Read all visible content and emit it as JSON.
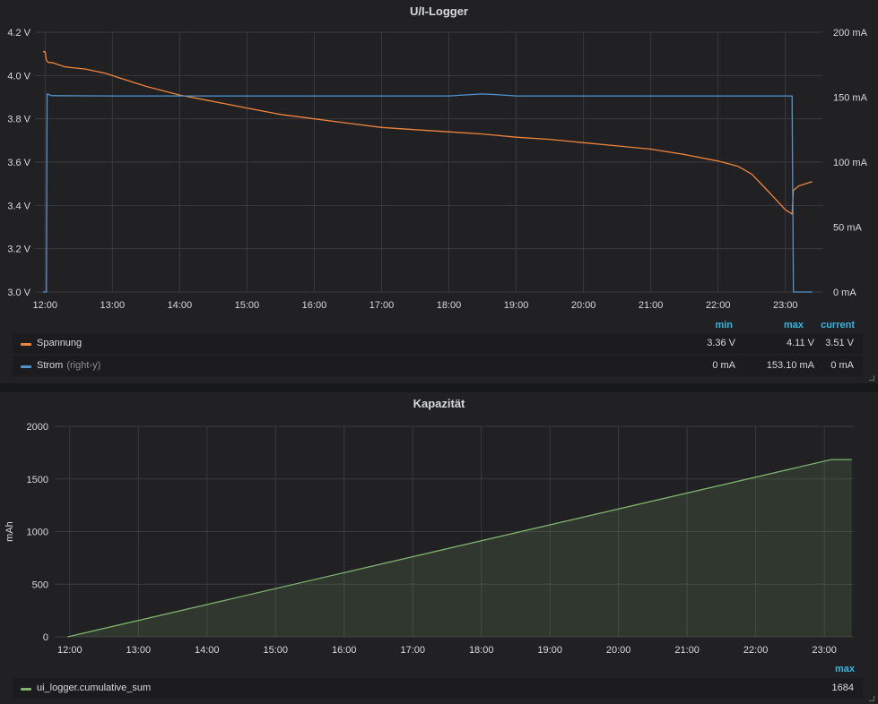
{
  "colors": {
    "spannung": "#ef843c",
    "strom": "#5195ce",
    "cumsum": "#7eb26d",
    "legend_header": "#33b5e5",
    "grid": "#3a3a3e",
    "axis_text": "#d8d9da"
  },
  "panels": {
    "ui_logger": {
      "title": "U/I-Logger",
      "legend": {
        "headers": [
          "min",
          "max",
          "current"
        ],
        "rows": [
          {
            "name": "Spannung",
            "suffix": "",
            "min": "3.36 V",
            "max": "4.11 V",
            "current": "3.51 V"
          },
          {
            "name": "Strom",
            "suffix": "(right-y)",
            "min": "0 mA",
            "max": "153.10 mA",
            "current": "0 mA"
          }
        ]
      }
    },
    "kapazitaet": {
      "title": "Kapazität",
      "legend": {
        "headers": [
          "max"
        ],
        "rows": [
          {
            "name": "ui_logger.cumulative_sum",
            "max": "1684"
          }
        ]
      }
    }
  },
  "chart_data": [
    {
      "type": "line",
      "title": "U/I-Logger",
      "x_ticks": [
        "12:00",
        "13:00",
        "14:00",
        "15:00",
        "16:00",
        "17:00",
        "18:00",
        "19:00",
        "20:00",
        "21:00",
        "22:00",
        "23:00"
      ],
      "y_left": {
        "ylim": [
          3.0,
          4.2
        ],
        "ticks": [
          "3.0 V",
          "3.2 V",
          "3.4 V",
          "3.6 V",
          "3.8 V",
          "4.0 V",
          "4.2 V"
        ]
      },
      "y_right": {
        "ylim": [
          0,
          200
        ],
        "ticks": [
          "0 mA",
          "50 mA",
          "100 mA",
          "150 mA",
          "200 mA"
        ]
      },
      "grid": true,
      "legend_position": "bottom",
      "series": [
        {
          "name": "Spannung",
          "axis": "left",
          "x": [
            11.97,
            12.0,
            12.02,
            12.05,
            12.1,
            12.3,
            12.6,
            12.9,
            13.2,
            13.5,
            14.0,
            14.5,
            15.0,
            15.5,
            16.0,
            16.5,
            17.0,
            17.5,
            18.0,
            18.5,
            19.0,
            19.5,
            20.0,
            20.5,
            21.0,
            21.5,
            22.0,
            22.3,
            22.5,
            22.7,
            22.85,
            23.0,
            23.1,
            23.12,
            23.2,
            23.4
          ],
          "y": [
            4.11,
            4.11,
            4.07,
            4.06,
            4.06,
            4.04,
            4.03,
            4.01,
            3.98,
            3.95,
            3.91,
            3.88,
            3.85,
            3.82,
            3.8,
            3.78,
            3.76,
            3.75,
            3.74,
            3.73,
            3.715,
            3.705,
            3.69,
            3.675,
            3.66,
            3.635,
            3.605,
            3.58,
            3.545,
            3.48,
            3.43,
            3.38,
            3.36,
            3.47,
            3.49,
            3.51
          ]
        },
        {
          "name": "Strom",
          "axis": "right",
          "x": [
            11.97,
            12.02,
            12.03,
            12.1,
            13.0,
            14.0,
            15.0,
            16.0,
            17.0,
            18.0,
            18.5,
            18.7,
            19.0,
            20.0,
            21.0,
            22.0,
            23.0,
            23.1,
            23.12,
            23.4
          ],
          "y": [
            0,
            0,
            152.5,
            151.2,
            151.0,
            151.0,
            151.0,
            151.0,
            151.0,
            151.0,
            152.5,
            152.0,
            151.0,
            151.0,
            151.0,
            151.0,
            151.0,
            151.0,
            0,
            0
          ]
        }
      ]
    },
    {
      "type": "area",
      "title": "Kapazität",
      "ylabel": "mAh",
      "x_ticks": [
        "12:00",
        "13:00",
        "14:00",
        "15:00",
        "16:00",
        "17:00",
        "18:00",
        "19:00",
        "20:00",
        "21:00",
        "22:00",
        "23:00"
      ],
      "ylim": [
        0,
        2000
      ],
      "y_ticks": [
        "0",
        "500",
        "1000",
        "1500",
        "2000"
      ],
      "grid": true,
      "legend_position": "bottom",
      "series": [
        {
          "name": "ui_logger.cumulative_sum",
          "x": [
            11.97,
            23.1,
            23.4
          ],
          "y": [
            0,
            1684,
            1684
          ]
        }
      ]
    }
  ]
}
